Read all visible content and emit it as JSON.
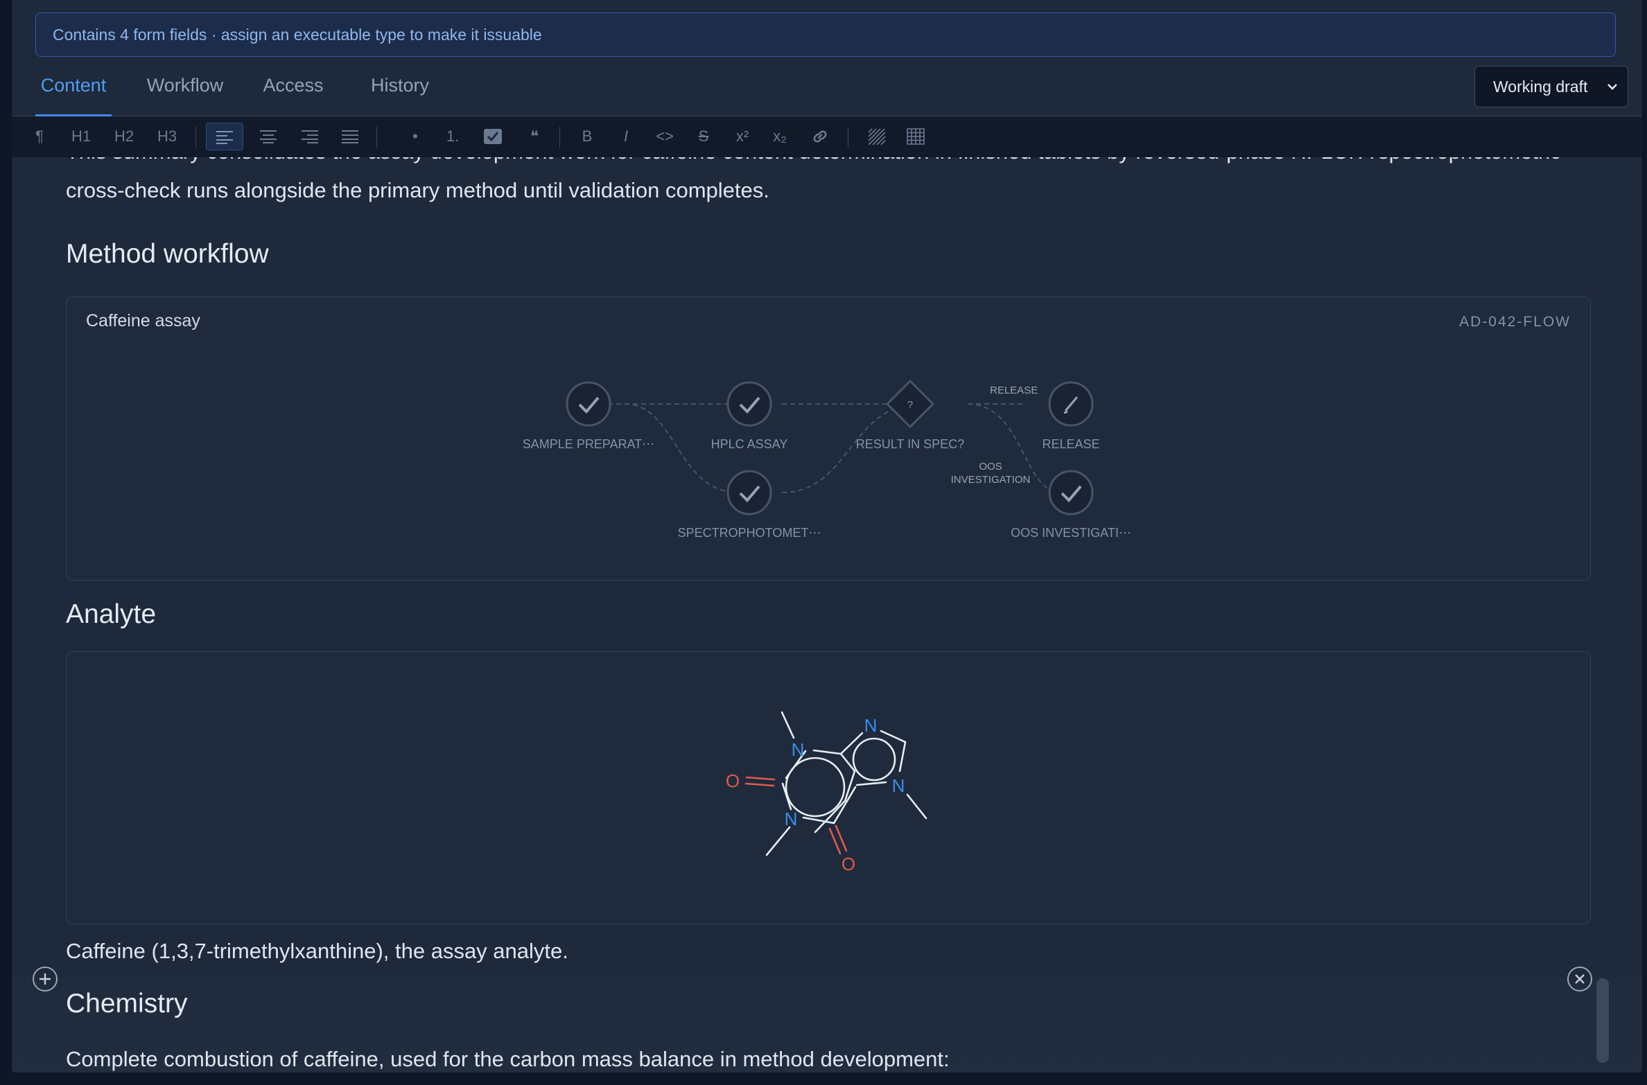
{
  "banner": {
    "text": "Contains 4 form fields · assign an executable type to make it issuable"
  },
  "tabs": [
    {
      "label": "Content",
      "active": true
    },
    {
      "label": "Workflow",
      "active": false
    },
    {
      "label": "Access",
      "active": false
    },
    {
      "label": "History",
      "active": false
    }
  ],
  "version_select": {
    "value": "Working draft"
  },
  "toolbar": {
    "paragraph": "¶",
    "h1": "H1",
    "h2": "H2",
    "h3": "H3",
    "bullet": "•",
    "ordered": "1.",
    "quote": "❝",
    "bold": "B",
    "italic": "I",
    "code": "<>",
    "strike": "S",
    "superscript": "x²",
    "subscript": "x₂",
    "icons": [
      "paragraph-icon",
      "align-left-icon",
      "align-center-icon",
      "align-right-icon",
      "align-justify-icon",
      "checklist-icon",
      "link-icon",
      "hatch-pattern-icon",
      "table-grid-icon"
    ]
  },
  "document": {
    "intro_line1": "This summary consolidates the assay development work for caffeine content determination in finished tablets by reversed-phase HPLC. A spectrophotometric",
    "intro_line2": "cross-check runs alongside the primary method until validation completes.",
    "section_workflow": "Method workflow",
    "workflow_card": {
      "title": "Caffeine assay",
      "code": "AD-042-FLOW",
      "nodes": {
        "sample_prep": "SAMPLE PREPARAT⋯",
        "hplc": "HPLC ASSAY",
        "spectro": "SPECTROPHOTOMET⋯",
        "decision": "RESULT IN SPEC?",
        "decision_mark": "?",
        "release": "RELEASE",
        "oos": "OOS INVESTIGATI⋯"
      },
      "edges": {
        "release": "RELEASE",
        "oos_line1": "OOS",
        "oos_line2": "INVESTIGATION"
      }
    },
    "section_analyte": "Analyte",
    "molecule_atoms": {
      "n1": "N",
      "n2": "N",
      "n3": "N",
      "n4": "N",
      "o1": "O",
      "o2": "O"
    },
    "analyte_caption": "Caffeine (1,3,7-trimethylxanthine), the assay analyte.",
    "section_chemistry": "Chemistry",
    "chemistry_line": "Complete combustion of caffeine, used for the carbon mass balance in method development:"
  },
  "colors": {
    "accent": "#4f9ef0",
    "nitrogen": "#3b8de8",
    "oxygen": "#e05a4e",
    "banner_border": "#2f5aa8"
  }
}
